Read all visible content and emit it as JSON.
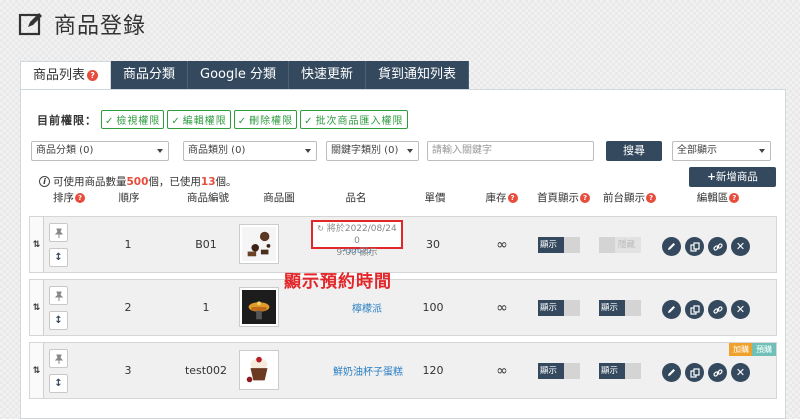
{
  "page": {
    "title": "商品登錄",
    "icon": "edit-icon"
  },
  "tabs": [
    {
      "label": "商品列表",
      "active": true,
      "has_help": true
    },
    {
      "label": "商品分類"
    },
    {
      "label": "Google 分類"
    },
    {
      "label": "快速更新"
    },
    {
      "label": "貨到通知列表"
    }
  ],
  "permissions": {
    "title": "目前權限：",
    "items": [
      "檢視權限",
      "編輯權限",
      "刪除權限",
      "批次商品匯入權限"
    ]
  },
  "filters": {
    "category": "商品分類 (0)",
    "category_type": "商品類別 (0)",
    "keyword_type": "關鍵字類別 (0)",
    "keyword_placeholder": "請輸入關鍵字",
    "search_label": "搜尋",
    "display": "全部顯示"
  },
  "usage": {
    "pre": "可使用商品數量",
    "max": "500",
    "mid": "個，已使用",
    "used": "13",
    "post": "個。"
  },
  "add_button": "新增商品",
  "columns": {
    "sort": "排序",
    "seq": "順序",
    "code": "商品編號",
    "image": "商品圖",
    "name": "品名",
    "price": "單價",
    "stock": "庫存",
    "home": "首頁顯示",
    "front": "前台顯示",
    "edit": "編輯區"
  },
  "rows": [
    {
      "seq": "1",
      "code": "B01",
      "schedule_line1": "將於2022/08/24 0",
      "schedule_line2": "9:00 顯示",
      "name": "巧克力",
      "price": "30",
      "stock": "∞",
      "home": "顯示",
      "front": "隱藏"
    },
    {
      "seq": "2",
      "code": "1",
      "name": "檸檬派",
      "price": "100",
      "stock": "∞",
      "home": "顯示",
      "front": "顯示"
    },
    {
      "seq": "3",
      "code": "test002",
      "name": "鮮奶油杯子蛋糕",
      "price": "120",
      "stock": "∞",
      "home": "顯示",
      "front": "顯示",
      "tag_addon": "加購",
      "tag_preorder": "預購"
    }
  ],
  "annotation": "顯示預約時間",
  "colors": {
    "dark": "#34495e",
    "red": "#e3262a",
    "green": "#2e9c3f",
    "link": "#2b7fc4",
    "orange": "#f0a12c",
    "teal": "#6fc1b7"
  }
}
